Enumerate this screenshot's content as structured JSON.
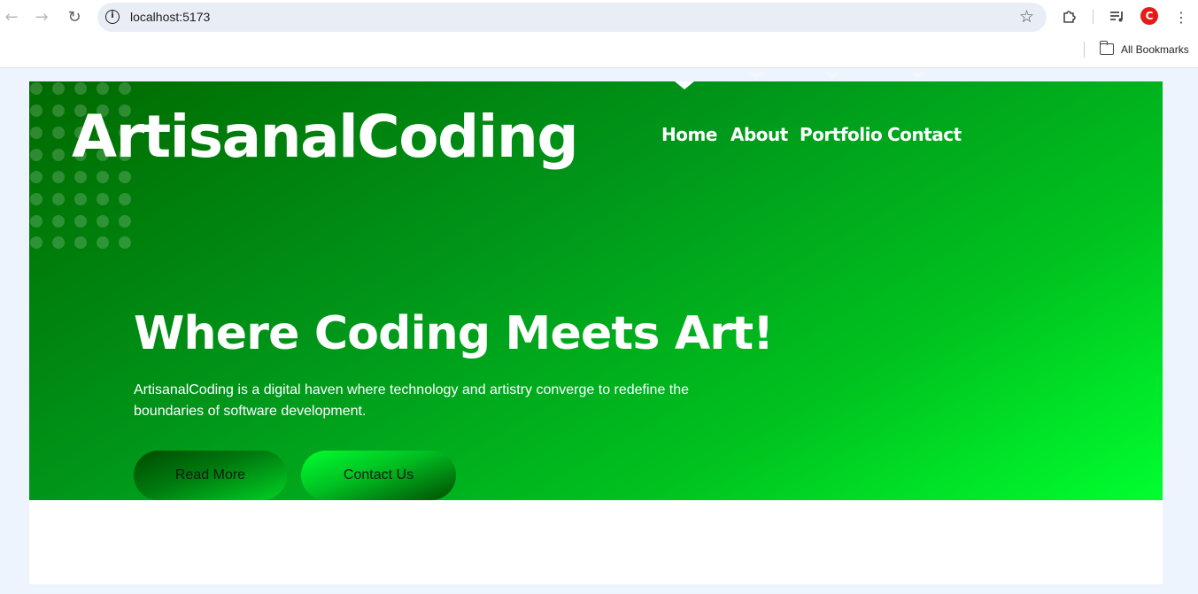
{
  "browser": {
    "back_icon": "arrow-left-icon",
    "forward_icon": "arrow-right-icon",
    "reload_icon": "reload-icon",
    "url": "localhost:5173",
    "bookmarks_label": "All Bookmarks"
  },
  "site": {
    "logo": "ArtisanalCoding",
    "nav": [
      "Home",
      "About",
      "Portfolio",
      "Contact"
    ],
    "hero": {
      "headline": "Where Coding Meets Art!",
      "description": "ArtisanalCoding is a digital haven where technology and artistry converge to redefine the boundaries of software development.",
      "read_more": "Read More",
      "contact_us": "Contact Us"
    }
  },
  "colors": {
    "hero_gradient_start": "#006a00",
    "hero_gradient_end": "#00ff2f",
    "text": "#ffffff"
  }
}
